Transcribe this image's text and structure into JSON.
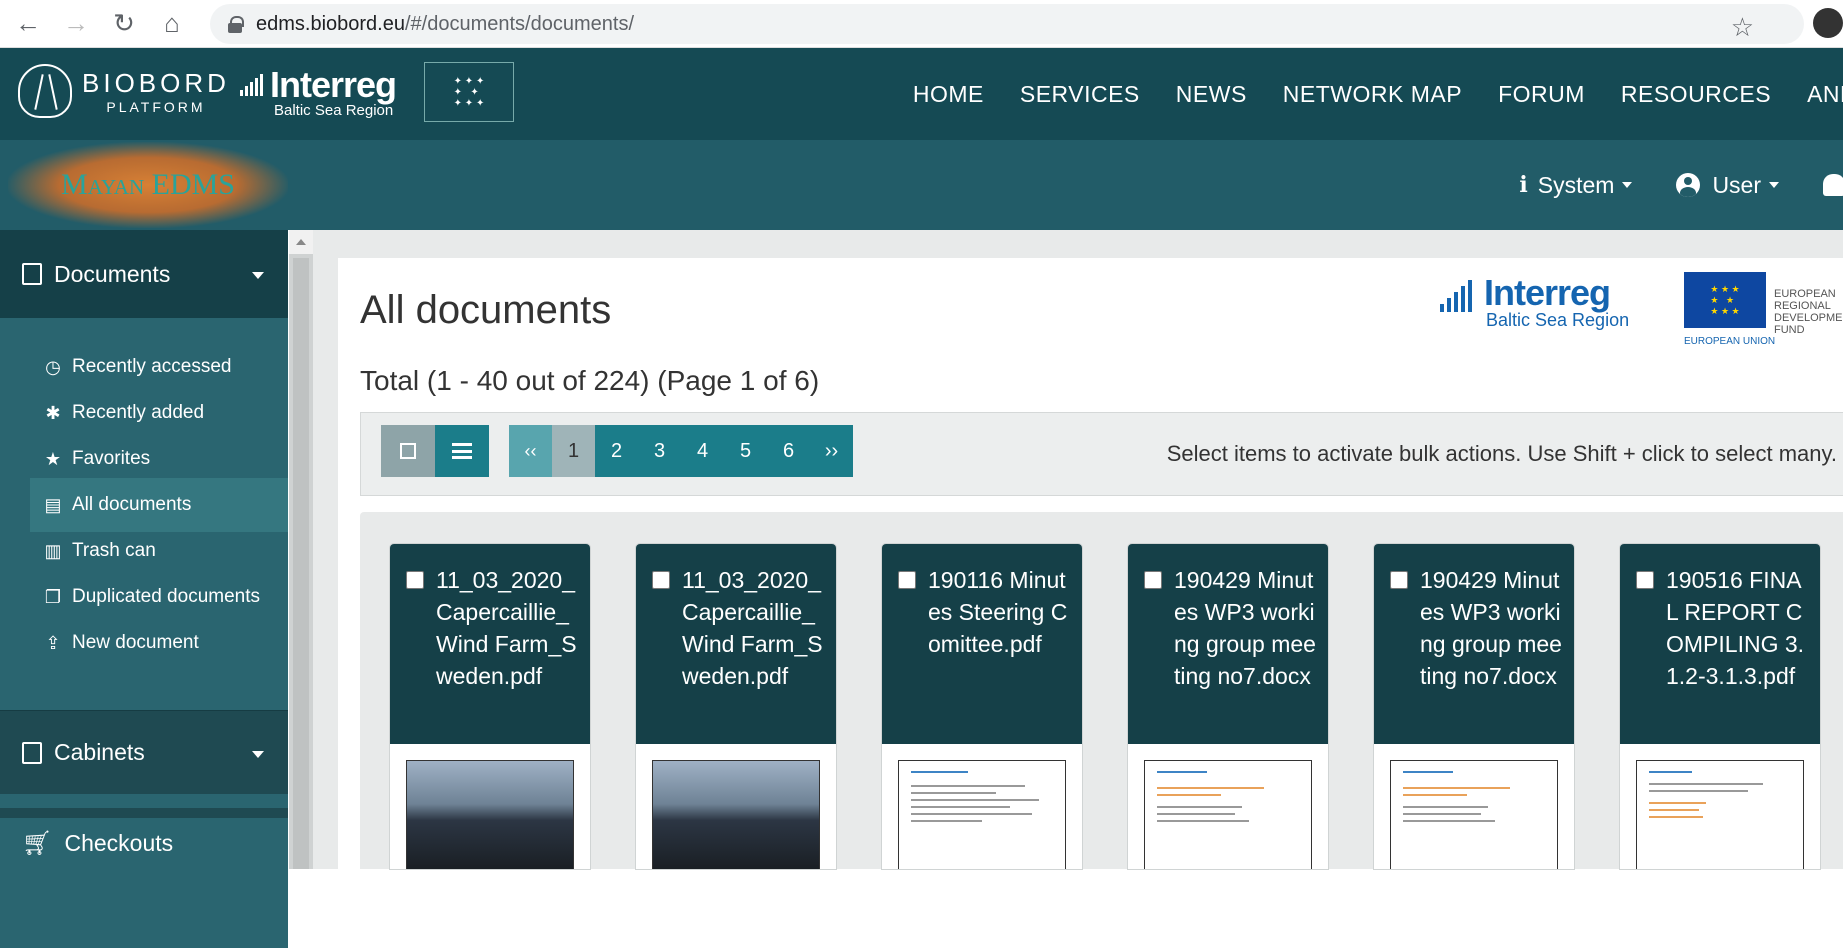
{
  "browser": {
    "url_host": "edms.biobord.eu",
    "url_path": "/#/documents/documents/"
  },
  "site": {
    "biobord_name": "BIOBORD",
    "biobord_sub": "PLATFORM",
    "interreg_name": "Interreg",
    "interreg_sub": "Baltic Sea Region",
    "nav": [
      "HOME",
      "SERVICES",
      "NEWS",
      "NETWORK MAP",
      "FORUM",
      "RESOURCES",
      "ANNA"
    ]
  },
  "app": {
    "logo": "Mayan EDMS",
    "system_menu": "System",
    "user_menu": "User"
  },
  "sidebar": {
    "documents_label": "Documents",
    "items": [
      {
        "label": "Recently accessed",
        "icon": "clock-icon"
      },
      {
        "label": "Recently added",
        "icon": "asterisk-icon"
      },
      {
        "label": "Favorites",
        "icon": "star-icon"
      },
      {
        "label": "All documents",
        "icon": "book-icon"
      },
      {
        "label": "Trash can",
        "icon": "trash-icon"
      },
      {
        "label": "Duplicated documents",
        "icon": "copy-icon"
      },
      {
        "label": "New document",
        "icon": "upload-icon"
      }
    ],
    "cabinets_label": "Cabinets",
    "checkouts_label": "Checkouts"
  },
  "main": {
    "title": "All documents",
    "total": "Total (1 - 40 out of 224) (Page 1 of 6)",
    "interreg_name": "Interreg",
    "interreg_sub": "Baltic Sea Region",
    "eu_text_1": "EUROPEAN",
    "eu_text_2": "REGIONAL",
    "eu_text_3": "DEVELOPMENT",
    "eu_text_4": "FUND",
    "eu_union": "EUROPEAN UNION",
    "pager": {
      "first": "‹‹",
      "pages": [
        "1",
        "2",
        "3",
        "4",
        "5",
        "6"
      ],
      "last": "››",
      "current": "1"
    },
    "bulk_hint": "Select items to activate bulk actions. Use Shift + click to select many.",
    "documents": [
      {
        "title": "11_03_2020_Capercaillie_Wind Farm_Sweden.pdf",
        "thumb": "photo"
      },
      {
        "title": "11_03_2020_Capercaillie_Wind Farm_Sweden.pdf",
        "thumb": "photo"
      },
      {
        "title": "190116 Minutes Steering Comittee.pdf",
        "thumb": "doc"
      },
      {
        "title": "190429 Minutes WP3 working group meeting no7.docx",
        "thumb": "doc-orange"
      },
      {
        "title": "190429 Minutes WP3 working group meeting no7.docx",
        "thumb": "doc-orange"
      },
      {
        "title": "190516 FINAL REPORT COMPILING 3.1.2-3.1.3.pdf",
        "thumb": "doc-blue"
      }
    ]
  }
}
